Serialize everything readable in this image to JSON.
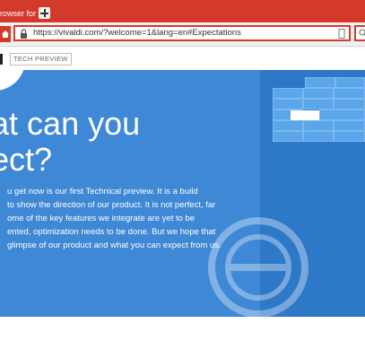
{
  "browser": {
    "tab_title": "rowser for",
    "address": "https://vivaldi.com/?welcome=1&lang=en#Expectations"
  },
  "page": {
    "badge": "TECH PREVIEW",
    "hero_title": [
      "hat can you",
      "pect?"
    ],
    "hero_text": [
      "u get now is our first Technical preview. It is a build",
      "to show the direction of our product. It is not perfect, far",
      "ome of the key features we integrate are yet to be",
      "ented, optimization needs to be done. But we hope that",
      "glimpse of our product and what you can expect from us."
    ]
  },
  "colors": {
    "browser_accent": "#d33a2c",
    "hero_blue": "#3f88d6"
  }
}
